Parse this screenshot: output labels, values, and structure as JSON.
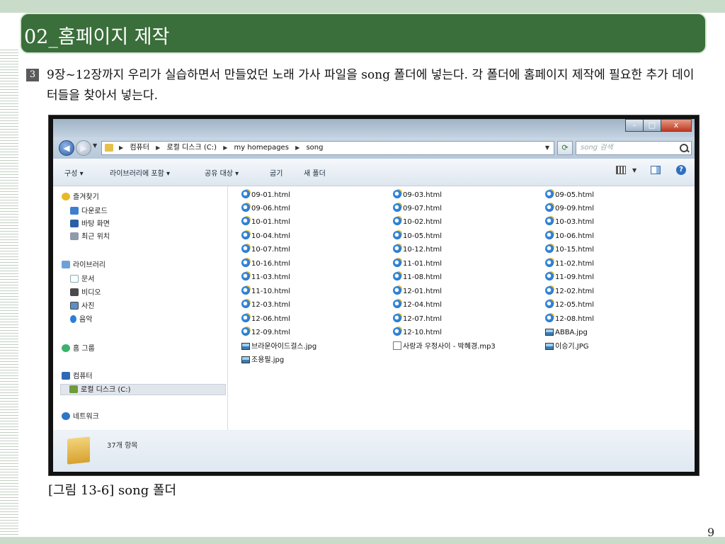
{
  "slide": {
    "title": "02_홈페이지 제작",
    "step_number": "3",
    "instruction": "9장~12장까지 우리가 실습하면서 만들었던 노래 가사 파일을 song 폴더에 넣는다. 각 폴더에 홈페이지 제작에 필요한 추가 데이터들을 찾아서 넣는다.",
    "caption": "[그림 13-6] song 폴더",
    "page_number": "9"
  },
  "window": {
    "caption_buttons": {
      "minimize": "–",
      "maximize": "□",
      "close": "x"
    },
    "breadcrumbs": [
      "컴퓨터",
      "로컬 디스크 (C:)",
      "my homepages",
      "song"
    ],
    "search_placeholder": "song 검색",
    "toolbar": [
      "구성 ▾",
      "라이브러리에 포함 ▾",
      "공유 대상 ▾",
      "굽기",
      "새 폴더"
    ],
    "nav": {
      "favorites_header": "즐겨찾기",
      "favorites": [
        "다운로드",
        "바탕 화면",
        "최근 위치"
      ],
      "libraries_header": "라이브러리",
      "libraries": [
        "문서",
        "비디오",
        "사진",
        "음악"
      ],
      "homegroup": "홈 그룹",
      "computer_header": "컴퓨터",
      "local_disk": "로컬 디스크 (C:)",
      "network": "네트워크"
    },
    "files": [
      "09-01.html",
      "09-03.html",
      "09-05.html",
      "09-06.html",
      "09-07.html",
      "09-09.html",
      "10-01.html",
      "10-02.html",
      "10-03.html",
      "10-04.html",
      "10-05.html",
      "10-06.html",
      "10-07.html",
      "10-12.html",
      "10-15.html",
      "10-16.html",
      "11-01.html",
      "11-02.html",
      "11-03.html",
      "11-08.html",
      "11-09.html",
      "11-10.html",
      "12-01.html",
      "12-02.html",
      "12-03.html",
      "12-04.html",
      "12-05.html",
      "12-06.html",
      "12-07.html",
      "12-08.html",
      "12-09.html",
      "12-10.html",
      "ABBA.jpg",
      "브라운아이드걸스.jpg",
      "사랑과 우정사이 - 박혜경.mp3",
      "이승기.JPG",
      "조용필.jpg"
    ],
    "status": "37개 항목"
  }
}
